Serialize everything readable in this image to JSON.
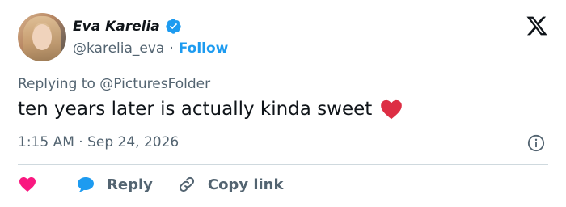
{
  "author": {
    "display_name": "Eva Karelia",
    "handle": "@karelia_eva",
    "separator": "·",
    "follow_label": "Follow"
  },
  "tweet": {
    "replying_to": "Replying to @PicturesFolder",
    "text": "ten years later is actually kinda sweet",
    "emoji": "red-heart",
    "timestamp": "1:15 AM · Sep 24, 2026"
  },
  "actions": {
    "reply_label": "Reply",
    "copy_link_label": "Copy link"
  },
  "colors": {
    "accent": "#1d9bf0",
    "heart": "#f91880",
    "text_primary": "#0f1419",
    "text_secondary": "#536471",
    "divider": "#cfd9de"
  },
  "icons": [
    "verified-badge-icon",
    "x-logo-icon",
    "red-heart-emoji",
    "info-icon",
    "heart-icon",
    "reply-bubble-icon",
    "link-icon"
  ]
}
